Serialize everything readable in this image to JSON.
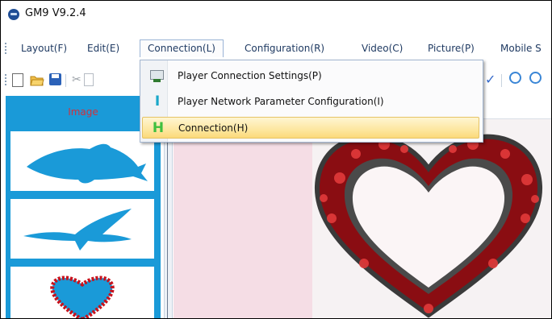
{
  "window": {
    "title": "GM9 V9.2.4"
  },
  "menubar": {
    "items": [
      {
        "label": "Layout(F)"
      },
      {
        "label": "Edit(E)"
      },
      {
        "label": "Connection(L)"
      },
      {
        "label": "Configuration(R)"
      },
      {
        "label": "Video(C)"
      },
      {
        "label": "Picture(P)"
      },
      {
        "label": "Mobile S"
      }
    ]
  },
  "connection_menu": {
    "items": [
      {
        "label": "Player Connection Settings(P)",
        "icon": "monitor-icon"
      },
      {
        "label": "Player Network Parameter Configuration(I)",
        "icon": "letter-i-icon",
        "glyph": "I"
      },
      {
        "label": "Connection(H)",
        "icon": "letter-h-icon",
        "glyph": "H",
        "highlighted": true
      }
    ]
  },
  "side_panel": {
    "title": "Image",
    "tiles": [
      "dolphin",
      "eagle",
      "heart"
    ]
  },
  "colors": {
    "panel": "#1a9ad8",
    "title_red": "#d0313d",
    "heart": "#c8121c",
    "hl_gold": "#fbd97a"
  }
}
